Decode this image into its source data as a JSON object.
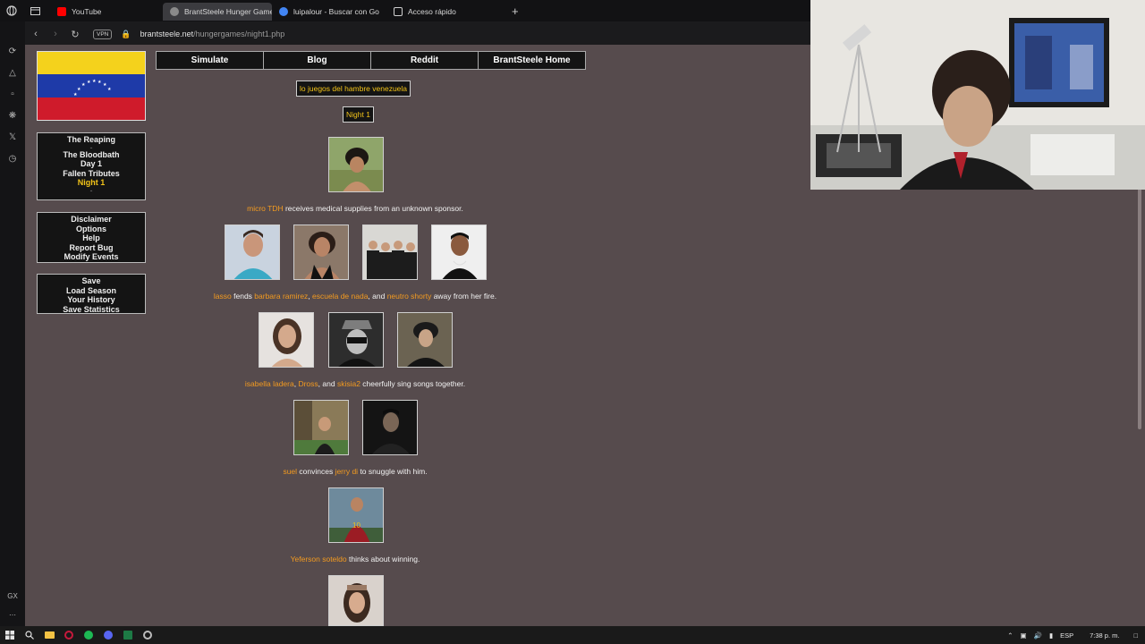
{
  "browser": {
    "tabs": [
      {
        "label": "YouTube",
        "favicon_color": "#ff0000",
        "active": false
      },
      {
        "label": "BrantSteele Hunger Games",
        "favicon_color": "#8a8a8a",
        "active": true
      },
      {
        "label": "luipalour - Buscar con Go",
        "favicon_color": "#4285f4",
        "active": false
      },
      {
        "label": "Acceso rápido",
        "favicon_color": "#cfcfcf",
        "active": false
      }
    ],
    "address": {
      "vpn": "VPN",
      "domain": "brantsteele.net",
      "path": "/hungergames/night1.php"
    }
  },
  "sidebar": {
    "phases": [
      {
        "label": "The Reaping",
        "current": false
      },
      {
        "label": "-",
        "current": false
      },
      {
        "label": "The Bloodbath",
        "current": false
      },
      {
        "label": "Day 1",
        "current": false
      },
      {
        "label": "Fallen Tributes",
        "current": false
      },
      {
        "label": "Night 1",
        "current": true
      },
      {
        "label": "-",
        "current": false
      }
    ],
    "info_links": [
      "Disclaimer",
      "Options",
      "Help",
      "Report Bug",
      "Modify Events"
    ],
    "save_links": [
      "Save",
      "Load Season",
      "Your History",
      "Save Statistics"
    ]
  },
  "topnav": [
    "Simulate",
    "Blog",
    "Reddit",
    "BrantSteele Home"
  ],
  "season_title": "lo juegos del hambre venezuela",
  "phase_title": "Night 1",
  "events": [
    {
      "parts": [
        {
          "t": "micro TDH",
          "n": true
        },
        {
          "t": " receives medical supplies from an unknown sponsor.",
          "n": false
        }
      ]
    },
    {
      "parts": [
        {
          "t": "lasso",
          "n": true
        },
        {
          "t": " fends ",
          "n": false
        },
        {
          "t": "barbara ramirez",
          "n": true
        },
        {
          "t": ", ",
          "n": false
        },
        {
          "t": "escuela de nada",
          "n": true
        },
        {
          "t": ", and ",
          "n": false
        },
        {
          "t": "neutro shorty",
          "n": true
        },
        {
          "t": " away from her fire.",
          "n": false
        }
      ]
    },
    {
      "parts": [
        {
          "t": "isabella ladera",
          "n": true
        },
        {
          "t": ", ",
          "n": false
        },
        {
          "t": "Dross",
          "n": true
        },
        {
          "t": ", and ",
          "n": false
        },
        {
          "t": "skisia2",
          "n": true
        },
        {
          "t": " cheerfully sing songs together.",
          "n": false
        }
      ]
    },
    {
      "parts": [
        {
          "t": "suel",
          "n": true
        },
        {
          "t": " convinces ",
          "n": false
        },
        {
          "t": "jerry di",
          "n": true
        },
        {
          "t": " to snuggle with him.",
          "n": false
        }
      ]
    },
    {
      "parts": [
        {
          "t": "Yeferson soteldo",
          "n": true
        },
        {
          "t": " thinks about winning.",
          "n": false
        }
      ]
    }
  ],
  "taskbar": {
    "lang": "ESP",
    "time": "7:38 p. m."
  },
  "colors": {
    "page_bg": "#564b4d",
    "name_highlight": "#f29a20",
    "current_phase": "#f2c319"
  }
}
